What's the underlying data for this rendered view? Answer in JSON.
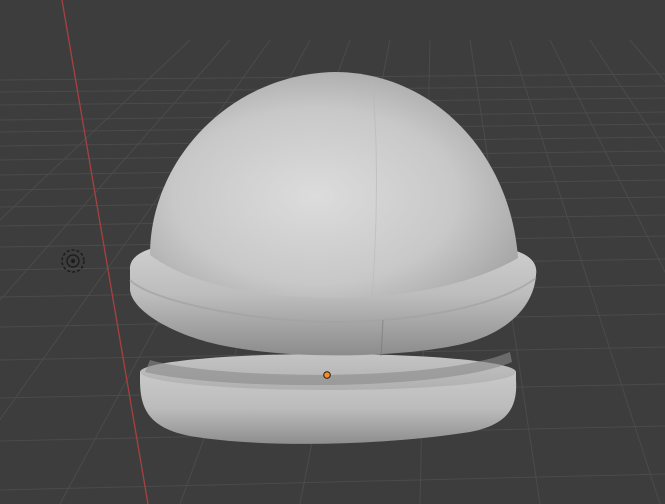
{
  "viewport": {
    "view": "perspective",
    "shading": "solid",
    "show_grid_floor": true,
    "show_x_axis": true
  },
  "scene_objects": [
    {
      "name": "dome-mesh",
      "type": "mesh",
      "selected": false
    },
    {
      "name": "light",
      "type": "light-icon"
    },
    {
      "name": "origin",
      "type": "object-origin"
    }
  ],
  "colors": {
    "background": "#3d3d3d",
    "grid_line": "#4a4a4a",
    "grid_line_far": "#444444",
    "x_axis": "#b24040",
    "mesh_base": "#b5b5b5",
    "mesh_highlight": "#dcdcdc",
    "mesh_shadow": "#8a8a8a",
    "origin_dot": "#ff8c1a"
  }
}
